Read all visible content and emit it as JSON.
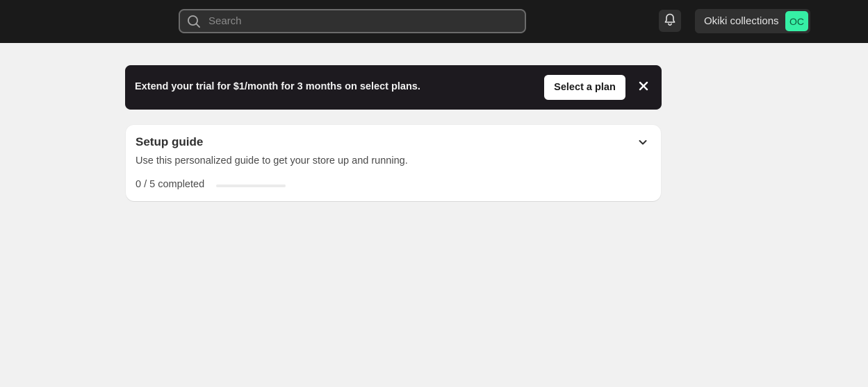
{
  "topbar": {
    "search": {
      "placeholder": "Search",
      "value": "",
      "icon": "search-icon"
    },
    "notifications": {
      "icon": "bell-icon"
    },
    "store": {
      "name": "Okiki collections",
      "avatar_initials": "OC",
      "avatar_color": "#36f0a5"
    }
  },
  "banner": {
    "message": "Extend your trial for $1/month for 3 months on select plans.",
    "action_label": "Select a plan",
    "close_icon": "close-icon"
  },
  "setup_guide": {
    "title": "Setup guide",
    "subtitle": "Use this personalized guide to get your store up and running.",
    "progress_text": "0 / 5 completed",
    "completed": 0,
    "total": 5,
    "expand_icon": "chevron-down-icon"
  },
  "colors": {
    "topbar_bg": "#1a1a1a",
    "banner_bg": "#1d1a1f",
    "page_bg": "#f1f1f1",
    "accent_avatar": "#36f0a5"
  }
}
